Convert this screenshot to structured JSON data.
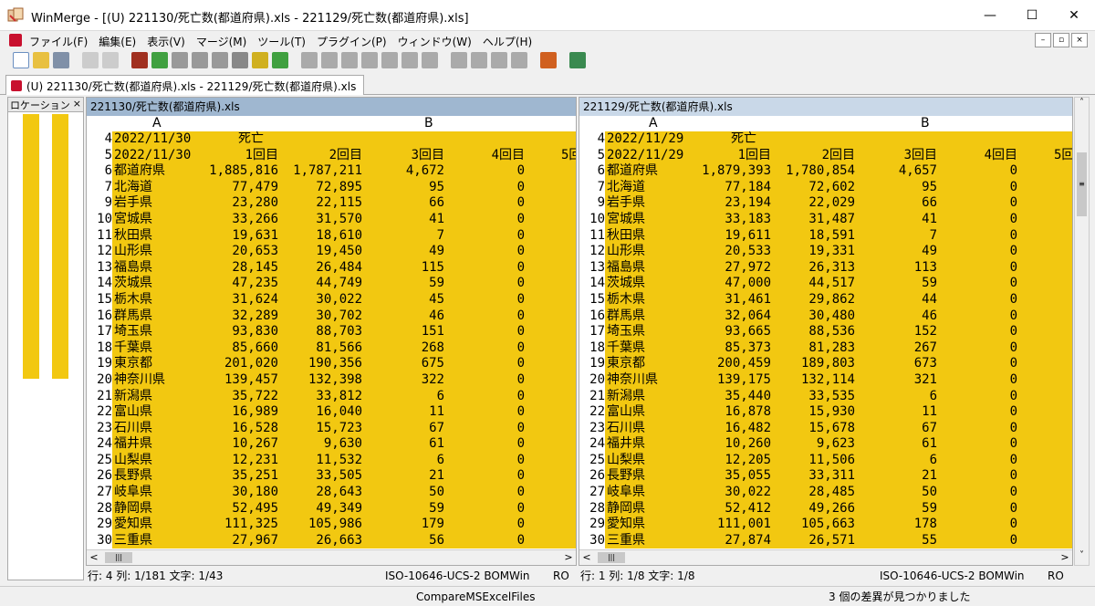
{
  "window": {
    "title": "WinMerge - [(U) 221130/死亡数(都道府県).xls - 221129/死亡数(都道府県).xls]",
    "minimize": "—",
    "maximize": "☐",
    "close": "✕"
  },
  "menu": [
    "ファイル(F)",
    "編集(E)",
    "表示(V)",
    "マージ(M)",
    "ツール(T)",
    "プラグイン(P)",
    "ウィンドウ(W)",
    "ヘルプ(H)"
  ],
  "mdi_buttons": [
    "–",
    "▫",
    "×"
  ],
  "doc_tab": "(U) 221130/死亡数(都道府県).xls - 221129/死亡数(都道府県).xls",
  "location_pane": {
    "title": "ロケーション ",
    "close": "×"
  },
  "left_pane": {
    "header": "221130/死亡数(都道府県).xls",
    "col_a": "A",
    "col_b": "B",
    "rows": [
      {
        "n": "4",
        "c0": "2022/11/30",
        "c1": "死亡",
        "c2": "",
        "c3": "",
        "c4": "",
        "c5": ""
      },
      {
        "n": "5",
        "c0": "2022/11/30",
        "c1": "1回目",
        "c2": "2回目",
        "c3": "3回目",
        "c4": "4回目",
        "c5": "5回"
      },
      {
        "n": "6",
        "c0": "都道府県",
        "c1": "1,885,816",
        "c2": "1,787,211",
        "c3": "4,672",
        "c4": "0",
        "c5": ""
      },
      {
        "n": "7",
        "c0": "北海道",
        "c1": "77,479",
        "c2": "72,895",
        "c3": "95",
        "c4": "0",
        "c5": ""
      },
      {
        "n": "9",
        "c0": "岩手県",
        "c1": "23,280",
        "c2": "22,115",
        "c3": "66",
        "c4": "0",
        "c5": ""
      },
      {
        "n": "10",
        "c0": "宮城県",
        "c1": "33,266",
        "c2": "31,570",
        "c3": "41",
        "c4": "0",
        "c5": ""
      },
      {
        "n": "11",
        "c0": "秋田県",
        "c1": "19,631",
        "c2": "18,610",
        "c3": "7",
        "c4": "0",
        "c5": ""
      },
      {
        "n": "12",
        "c0": "山形県",
        "c1": "20,653",
        "c2": "19,450",
        "c3": "49",
        "c4": "0",
        "c5": ""
      },
      {
        "n": "13",
        "c0": "福島県",
        "c1": "28,145",
        "c2": "26,484",
        "c3": "115",
        "c4": "0",
        "c5": ""
      },
      {
        "n": "14",
        "c0": "茨城県",
        "c1": "47,235",
        "c2": "44,749",
        "c3": "59",
        "c4": "0",
        "c5": ""
      },
      {
        "n": "15",
        "c0": "栃木県",
        "c1": "31,624",
        "c2": "30,022",
        "c3": "45",
        "c4": "0",
        "c5": ""
      },
      {
        "n": "16",
        "c0": "群馬県",
        "c1": "32,289",
        "c2": "30,702",
        "c3": "46",
        "c4": "0",
        "c5": ""
      },
      {
        "n": "17",
        "c0": "埼玉県",
        "c1": "93,830",
        "c2": "88,703",
        "c3": "151",
        "c4": "0",
        "c5": ""
      },
      {
        "n": "18",
        "c0": "千葉県",
        "c1": "85,660",
        "c2": "81,566",
        "c3": "268",
        "c4": "0",
        "c5": ""
      },
      {
        "n": "19",
        "c0": "東京都",
        "c1": "201,020",
        "c2": "190,356",
        "c3": "675",
        "c4": "0",
        "c5": ""
      },
      {
        "n": "20",
        "c0": "神奈川県",
        "c1": "139,457",
        "c2": "132,398",
        "c3": "322",
        "c4": "0",
        "c5": ""
      },
      {
        "n": "21",
        "c0": "新潟県",
        "c1": "35,722",
        "c2": "33,812",
        "c3": "6",
        "c4": "0",
        "c5": ""
      },
      {
        "n": "22",
        "c0": "富山県",
        "c1": "16,989",
        "c2": "16,040",
        "c3": "11",
        "c4": "0",
        "c5": ""
      },
      {
        "n": "23",
        "c0": "石川県",
        "c1": "16,528",
        "c2": "15,723",
        "c3": "67",
        "c4": "0",
        "c5": ""
      },
      {
        "n": "24",
        "c0": "福井県",
        "c1": "10,267",
        "c2": "9,630",
        "c3": "61",
        "c4": "0",
        "c5": ""
      },
      {
        "n": "25",
        "c0": "山梨県",
        "c1": "12,231",
        "c2": "11,532",
        "c3": "6",
        "c4": "0",
        "c5": ""
      },
      {
        "n": "26",
        "c0": "長野県",
        "c1": "35,251",
        "c2": "33,505",
        "c3": "21",
        "c4": "0",
        "c5": ""
      },
      {
        "n": "27",
        "c0": "岐阜県",
        "c1": "30,180",
        "c2": "28,643",
        "c3": "50",
        "c4": "0",
        "c5": ""
      },
      {
        "n": "28",
        "c0": "静岡県",
        "c1": "52,495",
        "c2": "49,349",
        "c3": "59",
        "c4": "0",
        "c5": ""
      },
      {
        "n": "29",
        "c0": "愛知県",
        "c1": "111,325",
        "c2": "105,986",
        "c3": "179",
        "c4": "0",
        "c5": ""
      },
      {
        "n": "30",
        "c0": "三重県",
        "c1": "27,967",
        "c2": "26,663",
        "c3": "56",
        "c4": "0",
        "c5": ""
      }
    ],
    "status": {
      "pos": "行: 4  列: 1/181  文字: 1/43",
      "enc": "ISO-10646-UCS-2 BOM",
      "eol": "Win",
      "ro": "RO"
    }
  },
  "right_pane": {
    "header": "221129/死亡数(都道府県).xls",
    "col_a": "A",
    "col_b": "B",
    "rows": [
      {
        "n": "4",
        "c0": "2022/11/29",
        "c1": "死亡",
        "c2": "",
        "c3": "",
        "c4": "",
        "c5": ""
      },
      {
        "n": "5",
        "c0": "2022/11/29",
        "c1": "1回目",
        "c2": "2回目",
        "c3": "3回目",
        "c4": "4回目",
        "c5": "5回"
      },
      {
        "n": "6",
        "c0": "都道府県",
        "c1": "1,879,393",
        "c2": "1,780,854",
        "c3": "4,657",
        "c4": "0",
        "c5": ""
      },
      {
        "n": "7",
        "c0": "北海道",
        "c1": "77,184",
        "c2": "72,602",
        "c3": "95",
        "c4": "0",
        "c5": ""
      },
      {
        "n": "9",
        "c0": "岩手県",
        "c1": "23,194",
        "c2": "22,029",
        "c3": "66",
        "c4": "0",
        "c5": ""
      },
      {
        "n": "10",
        "c0": "宮城県",
        "c1": "33,183",
        "c2": "31,487",
        "c3": "41",
        "c4": "0",
        "c5": ""
      },
      {
        "n": "11",
        "c0": "秋田県",
        "c1": "19,611",
        "c2": "18,591",
        "c3": "7",
        "c4": "0",
        "c5": ""
      },
      {
        "n": "12",
        "c0": "山形県",
        "c1": "20,533",
        "c2": "19,331",
        "c3": "49",
        "c4": "0",
        "c5": ""
      },
      {
        "n": "13",
        "c0": "福島県",
        "c1": "27,972",
        "c2": "26,313",
        "c3": "113",
        "c4": "0",
        "c5": ""
      },
      {
        "n": "14",
        "c0": "茨城県",
        "c1": "47,000",
        "c2": "44,517",
        "c3": "59",
        "c4": "0",
        "c5": ""
      },
      {
        "n": "15",
        "c0": "栃木県",
        "c1": "31,461",
        "c2": "29,862",
        "c3": "44",
        "c4": "0",
        "c5": ""
      },
      {
        "n": "16",
        "c0": "群馬県",
        "c1": "32,064",
        "c2": "30,480",
        "c3": "46",
        "c4": "0",
        "c5": ""
      },
      {
        "n": "17",
        "c0": "埼玉県",
        "c1": "93,665",
        "c2": "88,536",
        "c3": "152",
        "c4": "0",
        "c5": ""
      },
      {
        "n": "18",
        "c0": "千葉県",
        "c1": "85,373",
        "c2": "81,283",
        "c3": "267",
        "c4": "0",
        "c5": ""
      },
      {
        "n": "19",
        "c0": "東京都",
        "c1": "200,459",
        "c2": "189,803",
        "c3": "673",
        "c4": "0",
        "c5": ""
      },
      {
        "n": "20",
        "c0": "神奈川県",
        "c1": "139,175",
        "c2": "132,114",
        "c3": "321",
        "c4": "0",
        "c5": ""
      },
      {
        "n": "21",
        "c0": "新潟県",
        "c1": "35,440",
        "c2": "33,535",
        "c3": "6",
        "c4": "0",
        "c5": ""
      },
      {
        "n": "22",
        "c0": "富山県",
        "c1": "16,878",
        "c2": "15,930",
        "c3": "11",
        "c4": "0",
        "c5": ""
      },
      {
        "n": "23",
        "c0": "石川県",
        "c1": "16,482",
        "c2": "15,678",
        "c3": "67",
        "c4": "0",
        "c5": ""
      },
      {
        "n": "24",
        "c0": "福井県",
        "c1": "10,260",
        "c2": "9,623",
        "c3": "61",
        "c4": "0",
        "c5": ""
      },
      {
        "n": "25",
        "c0": "山梨県",
        "c1": "12,205",
        "c2": "11,506",
        "c3": "6",
        "c4": "0",
        "c5": ""
      },
      {
        "n": "26",
        "c0": "長野県",
        "c1": "35,055",
        "c2": "33,311",
        "c3": "21",
        "c4": "0",
        "c5": ""
      },
      {
        "n": "27",
        "c0": "岐阜県",
        "c1": "30,022",
        "c2": "28,485",
        "c3": "50",
        "c4": "0",
        "c5": ""
      },
      {
        "n": "28",
        "c0": "静岡県",
        "c1": "52,412",
        "c2": "49,266",
        "c3": "59",
        "c4": "0",
        "c5": ""
      },
      {
        "n": "29",
        "c0": "愛知県",
        "c1": "111,001",
        "c2": "105,663",
        "c3": "178",
        "c4": "0",
        "c5": ""
      },
      {
        "n": "30",
        "c0": "三重県",
        "c1": "27,874",
        "c2": "26,571",
        "c3": "55",
        "c4": "0",
        "c5": ""
      }
    ],
    "status": {
      "pos": "行: 1  列: 1/8  文字: 1/8",
      "enc": "ISO-10646-UCS-2 BOM",
      "eol": "Win",
      "ro": "RO"
    }
  },
  "scroll": {
    "left": "<",
    "right": ">",
    "up": "˄",
    "down": "˅",
    "thumb": "|||",
    "vthumb": "≡"
  },
  "statusbar": {
    "center": "CompareMSExcelFiles",
    "right": "3 個の差異が見つかりました"
  },
  "colors": {
    "diff": "#f2c811",
    "pane_header_left": "#9fb7d0",
    "pane_header_right": "#c9d8e8"
  }
}
